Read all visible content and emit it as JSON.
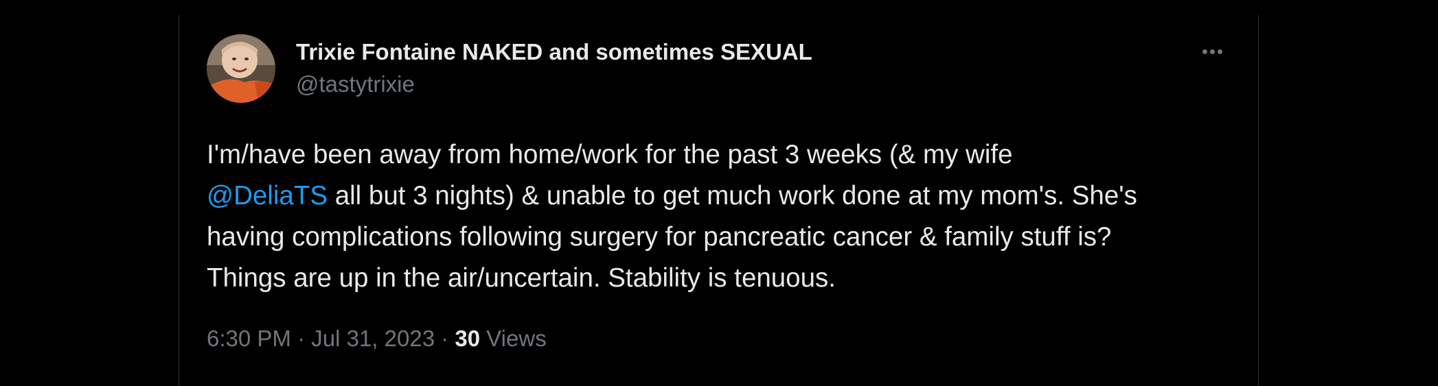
{
  "tweet": {
    "author": {
      "display_name": "Trixie Fontaine NAKED and sometimes SEXUAL",
      "handle": "@tastytrixie",
      "avatar_icon": "user-avatar-photo"
    },
    "more_icon": "more-horizontal-icon",
    "text": {
      "line1": "I'm/have been away from home/work for the past 3 weeks (& my wife",
      "mention": "@DeliaTS",
      "line2_rest": " all but 3 nights) & unable to get much work done at my mom's. She's",
      "line3": "having complications following surgery for pancreatic cancer & family stuff is?",
      "line4": "Things are up in the air/uncertain. Stability is tenuous."
    },
    "meta": {
      "time": "6:30 PM",
      "separator": " · ",
      "date": "Jul 31, 2023",
      "views_count": "30",
      "views_label": " Views"
    }
  },
  "colors": {
    "background": "#000000",
    "text": "#e7e9ea",
    "secondary": "#71767b",
    "link": "#1d9bf0",
    "border": "#2f3336"
  }
}
